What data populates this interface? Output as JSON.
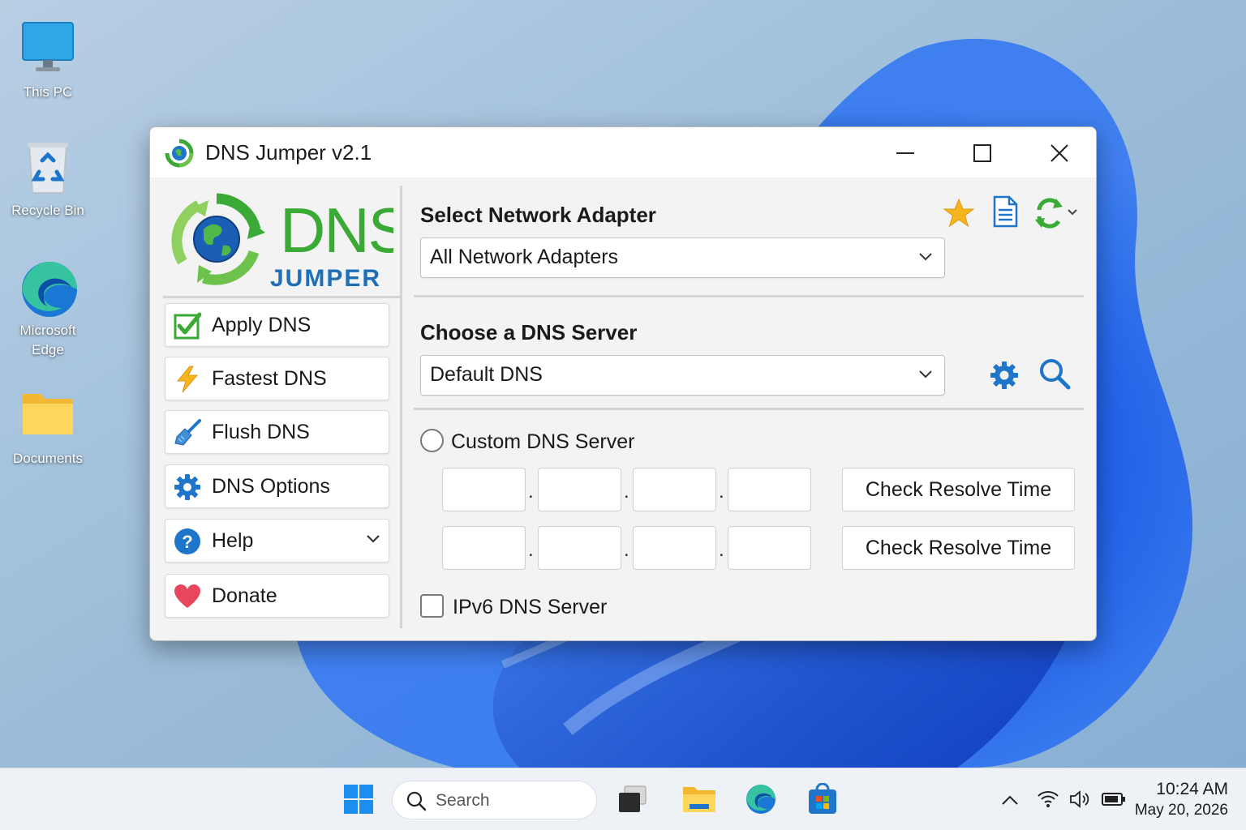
{
  "desktop": {
    "icons": [
      {
        "label": "This PC",
        "icon": "monitor-icon"
      },
      {
        "label": "Recycle Bin",
        "icon": "recycle-bin-icon"
      },
      {
        "label": "Microsoft Edge",
        "icon": "edge-icon"
      },
      {
        "label": "Documents",
        "icon": "folder-icon"
      }
    ]
  },
  "window": {
    "title": "DNS Jumper v2.1",
    "controls": [
      "minimize",
      "maximize",
      "close"
    ]
  },
  "logo": {
    "word1": "DNS",
    "word2": "JUMPER"
  },
  "sidebar": {
    "items": [
      {
        "label": "Apply DNS",
        "icon": "checkmark-icon"
      },
      {
        "label": "Fastest DNS",
        "icon": "lightning-icon"
      },
      {
        "label": "Flush DNS",
        "icon": "broom-icon"
      },
      {
        "label": "DNS Options",
        "icon": "gear-icon"
      },
      {
        "label": "Help",
        "icon": "help-icon",
        "has_dropdown": true
      },
      {
        "label": "Donate",
        "icon": "heart-icon"
      }
    ]
  },
  "adapter": {
    "title": "Select Network Adapter",
    "selected": "All Network Adapters",
    "tools": [
      "star-icon",
      "document-icon",
      "refresh-icon"
    ]
  },
  "dns_server": {
    "title": "Choose a DNS Server",
    "selected": "Default DNS",
    "tools": [
      "gear-icon",
      "search-icon"
    ]
  },
  "custom_dns": {
    "label": "Custom DNS Server",
    "checked": false,
    "ipv4_rows": [
      {
        "octets": [
          "",
          "",
          "",
          ""
        ],
        "button": "Check Resolve Time"
      },
      {
        "octets": [
          "",
          "",
          "",
          ""
        ],
        "button": "Check Resolve Time"
      }
    ]
  },
  "ipv6": {
    "label": "IPv6 DNS Server",
    "checked": false
  },
  "taskbar": {
    "search_placeholder": "Search",
    "pinned": [
      "start-icon",
      "search",
      "task-view-icon",
      "file-explorer-icon",
      "edge-icon",
      "store-icon"
    ],
    "tray": [
      "chevron-up-icon",
      "wifi-icon",
      "volume-icon",
      "battery-icon"
    ],
    "time": "10:24 AM",
    "date": "May 20, 2026"
  },
  "colors": {
    "accent_green": "#3aa935",
    "accent_blue": "#1f75c9",
    "logo_blue": "#1f6fb7",
    "heart_red": "#e8465c",
    "star_gold": "#f6b51e"
  }
}
